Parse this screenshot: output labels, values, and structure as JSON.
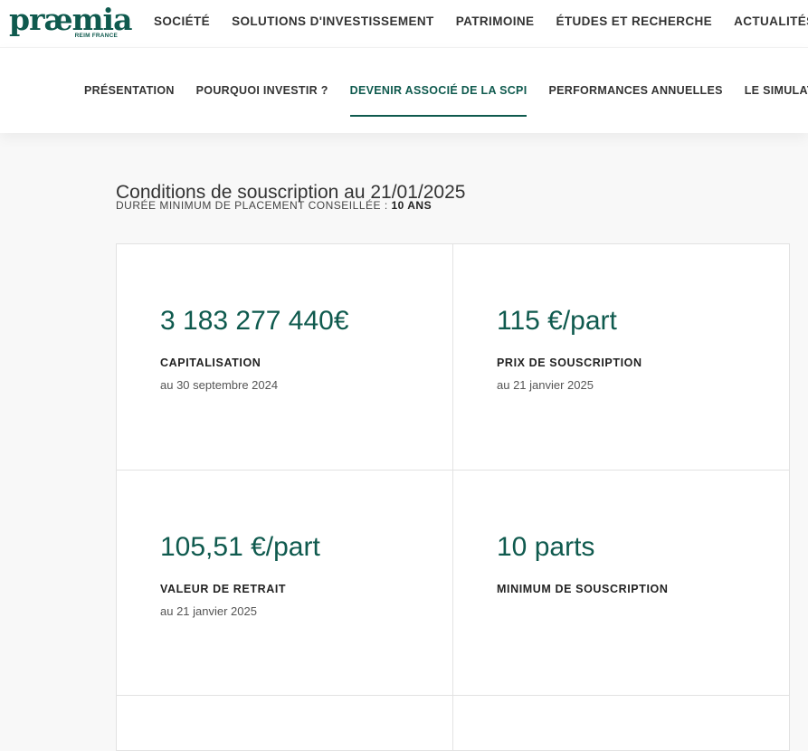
{
  "brand": {
    "name": "præmia",
    "tagline": "REIM FRANCE"
  },
  "main_nav": [
    "SOCIÉTÉ",
    "SOLUTIONS D'INVESTISSEMENT",
    "PATRIMOINE",
    "ÉTUDES ET RECHERCHE",
    "ACTUALITÉS"
  ],
  "sub_nav": {
    "tabs": [
      "PRÉSENTATION",
      "POURQUOI INVESTIR ?",
      "DEVENIR ASSOCIÉ DE LA SCPI",
      "PERFORMANCES ANNUELLES",
      "LE SIMULATEUR"
    ],
    "active_index": 2
  },
  "section": {
    "title": "Conditions de souscription au 21/01/2025",
    "subtitle_prefix": "DURÉE MINIMUM DE PLACEMENT CONSEILLÉE : ",
    "subtitle_value": "10 ANS"
  },
  "cards": [
    {
      "value": "3 183 277 440€",
      "label": "CAPITALISATION",
      "date": "au 30 septembre 2024"
    },
    {
      "value": "115 €/part",
      "label": "PRIX DE SOUSCRIPTION",
      "date": "au 21 janvier 2025"
    },
    {
      "value": "105,51 €/part",
      "label": "VALEUR DE RETRAIT",
      "date": "au 21 janvier 2025"
    },
    {
      "value": "10 parts",
      "label": "MINIMUM DE SOUSCRIPTION",
      "date": ""
    }
  ],
  "colors": {
    "accent": "#0f5a4e",
    "text": "#333333",
    "page_bg": "#f8f8f8"
  }
}
